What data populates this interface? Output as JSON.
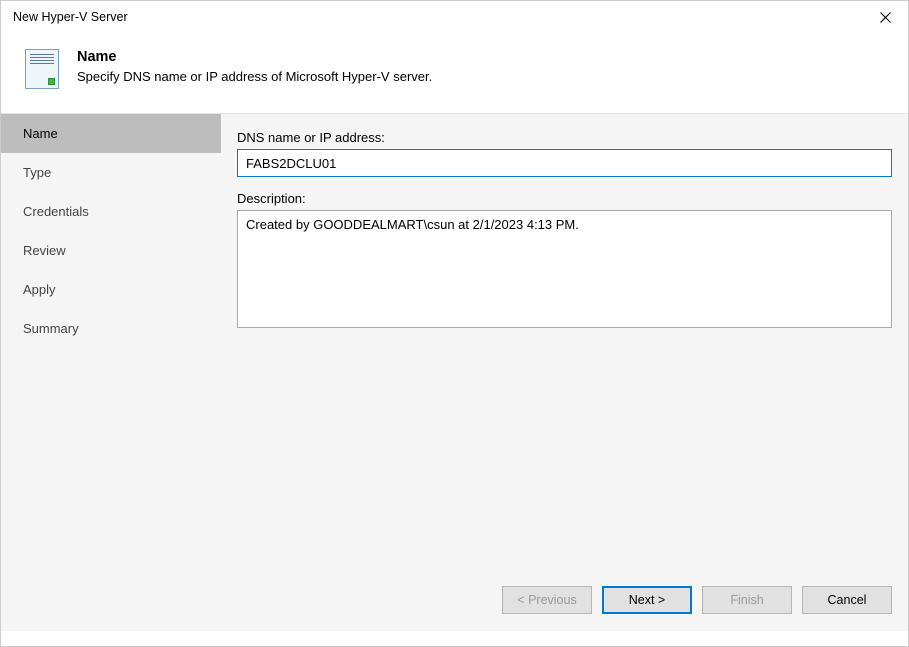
{
  "window": {
    "title": "New Hyper-V Server"
  },
  "header": {
    "title": "Name",
    "subtitle": "Specify DNS name or IP address of Microsoft Hyper-V server."
  },
  "sidebar": {
    "items": [
      {
        "label": "Name",
        "active": true
      },
      {
        "label": "Type",
        "active": false
      },
      {
        "label": "Credentials",
        "active": false
      },
      {
        "label": "Review",
        "active": false
      },
      {
        "label": "Apply",
        "active": false
      },
      {
        "label": "Summary",
        "active": false
      }
    ]
  },
  "form": {
    "dns_label": "DNS name or IP address:",
    "dns_value": "FABS2DCLU01",
    "desc_label": "Description:",
    "desc_value": "Created by GOODDEALMART\\csun at 2/1/2023 4:13 PM."
  },
  "buttons": {
    "previous": "< Previous",
    "next": "Next >",
    "finish": "Finish",
    "cancel": "Cancel"
  }
}
